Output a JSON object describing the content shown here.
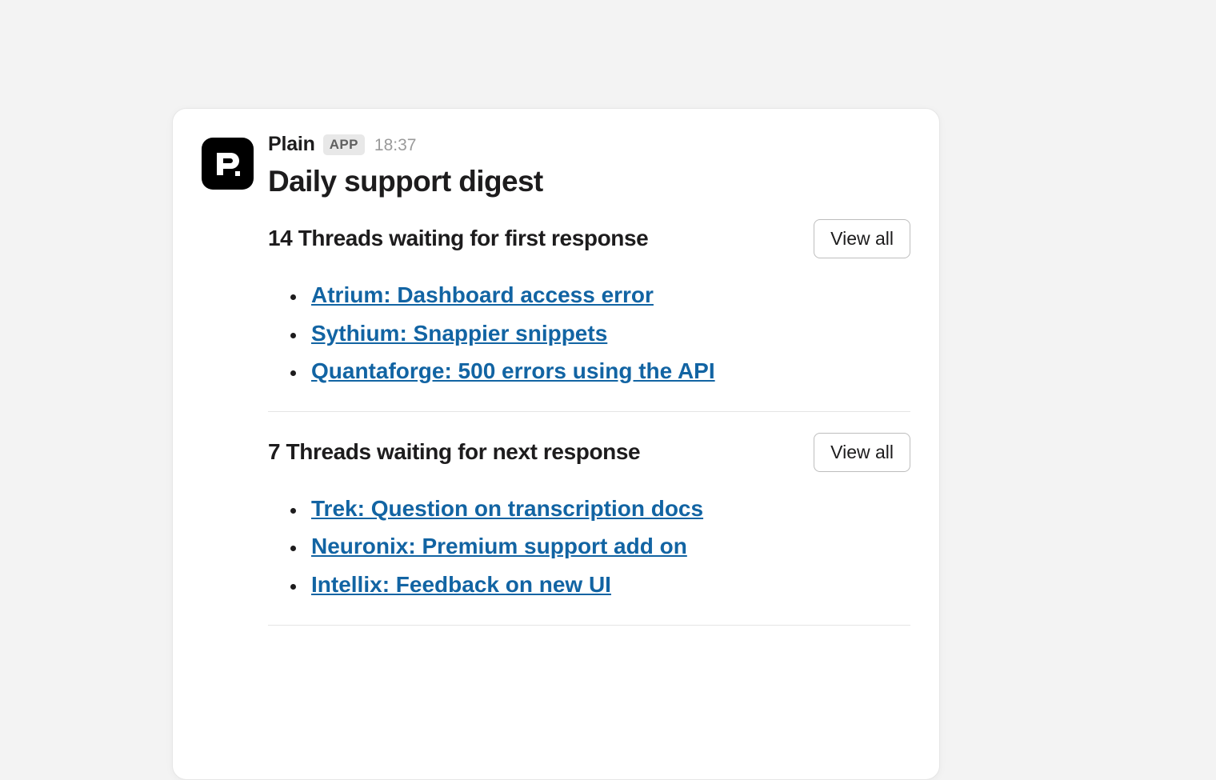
{
  "sender": {
    "name": "Plain",
    "badge": "APP",
    "timestamp": "18:37",
    "avatar_glyph": "P."
  },
  "digest": {
    "title": "Daily support digest"
  },
  "sections": [
    {
      "title": "14 Threads waiting for first response",
      "view_all_label": "View all",
      "threads": [
        "Atrium: Dashboard access error",
        "Sythium: Snappier snippets",
        "Quantaforge: 500 errors using the API"
      ]
    },
    {
      "title": "7 Threads waiting for next response",
      "view_all_label": "View all",
      "threads": [
        "Trek: Question on transcription docs",
        "Neuronix: Premium support add on",
        "Intellix: Feedback on new UI"
      ]
    }
  ]
}
